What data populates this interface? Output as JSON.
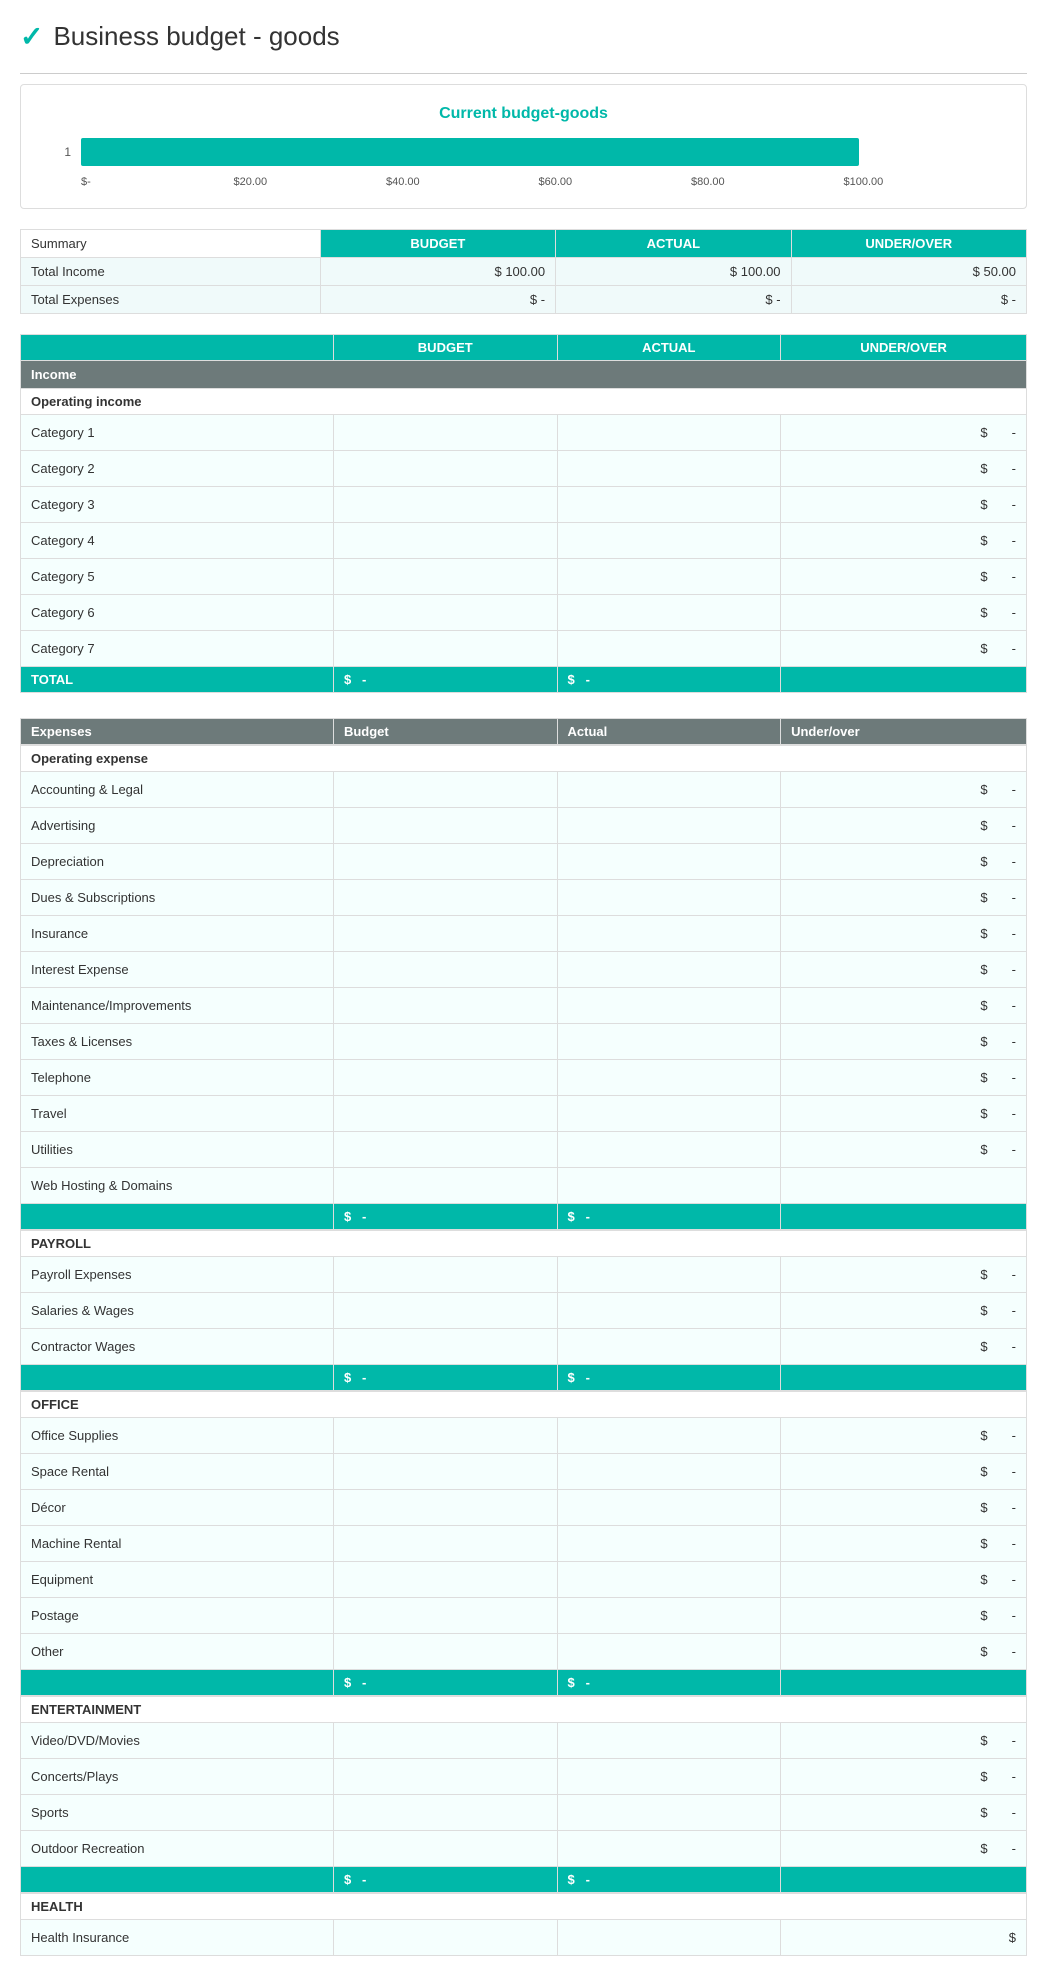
{
  "page": {
    "title": "Business budget - goods",
    "logo": "✓"
  },
  "chart": {
    "title": "Current budget-goods",
    "bar_width_pct": 85,
    "row_label": "1",
    "x_axis": [
      "$-",
      "$20.00",
      "$40.00",
      "$60.00",
      "$80.00",
      "$100.00"
    ]
  },
  "summary": {
    "headers": [
      "BUDGET",
      "ACTUAL",
      "UNDER/OVER"
    ],
    "rows": [
      {
        "label": "Total Income",
        "budget": "$ 100.00",
        "actual": "$ 100.00",
        "under": "$ 50.00"
      },
      {
        "label": "Total Expenses",
        "budget": "$   -",
        "actual": "$   -",
        "under": "$   -"
      }
    ]
  },
  "income_section": {
    "header": "Income",
    "col_headers": [
      "BUDGET",
      "ACTUAL",
      "UNDER/OVER"
    ],
    "sub_header": "Operating income",
    "categories": [
      "Category 1",
      "Category 2",
      "Category 3",
      "Category 4",
      "Category 5",
      "Category 6",
      "Category 7"
    ],
    "total_label": "TOTAL",
    "total_budget": "$",
    "total_budget_val": "-",
    "total_actual": "$",
    "total_actual_val": "-"
  },
  "expenses_section": {
    "header": "Expenses",
    "col_budget": "Budget",
    "col_actual": "Actual",
    "col_under": "Under/over",
    "groups": [
      {
        "label": "Operating expense",
        "items": [
          "Accounting & Legal",
          "Advertising",
          "Depreciation",
          "Dues & Subscriptions",
          "Insurance",
          "Interest Expense",
          "Maintenance/Improvements",
          "Taxes & Licenses",
          "Telephone",
          "Travel",
          "Utilities",
          "Web Hosting & Domains"
        ]
      },
      {
        "label": "PAYROLL",
        "items": [
          "Payroll Expenses",
          "Salaries & Wages",
          "Contractor Wages"
        ]
      },
      {
        "label": "OFFICE",
        "items": [
          "Office Supplies",
          "Space Rental",
          "Décor",
          "Machine Rental",
          "Equipment",
          "Postage",
          "Other"
        ]
      },
      {
        "label": "ENTERTAINMENT",
        "items": [
          "Video/DVD/Movies",
          "Concerts/Plays",
          "Sports",
          "Outdoor Recreation"
        ]
      },
      {
        "label": "HEALTH",
        "items": [
          "Health Insurance"
        ]
      }
    ]
  }
}
